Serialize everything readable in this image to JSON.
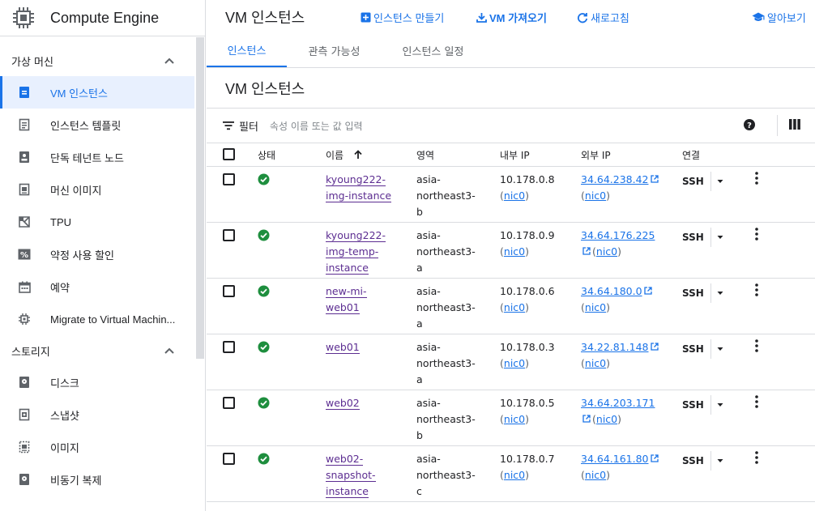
{
  "app": {
    "title": "Compute Engine"
  },
  "sidebar": {
    "sections": [
      {
        "label": "가상 머신",
        "items": [
          {
            "label": "VM 인스턴스",
            "icon": "vm-instance-icon",
            "active": true
          },
          {
            "label": "인스턴스 템플릿",
            "icon": "template-icon"
          },
          {
            "label": "단독 테넌트 노드",
            "icon": "sole-tenant-icon"
          },
          {
            "label": "머신 이미지",
            "icon": "machine-image-icon"
          },
          {
            "label": "TPU",
            "icon": "tpu-icon"
          },
          {
            "label": "약정 사용 할인",
            "icon": "percent-icon"
          },
          {
            "label": "예약",
            "icon": "calendar-icon"
          },
          {
            "label": "Migrate to Virtual Machin...",
            "icon": "migrate-icon"
          }
        ]
      },
      {
        "label": "스토리지",
        "items": [
          {
            "label": "디스크",
            "icon": "disk-icon"
          },
          {
            "label": "스냅샷",
            "icon": "snapshot-icon"
          },
          {
            "label": "이미지",
            "icon": "image-icon"
          },
          {
            "label": "비동기 복제",
            "icon": "async-replication-icon"
          }
        ]
      }
    ]
  },
  "header": {
    "page_title": "VM 인스턴스",
    "create_label": "인스턴스 만들기",
    "import_label": "VM 가져오기",
    "refresh_label": "새로고침",
    "learn_label": "알아보기"
  },
  "tabs": [
    {
      "label": "인스턴스",
      "active": true
    },
    {
      "label": "관측 가능성"
    },
    {
      "label": "인스턴스 일정"
    }
  ],
  "section_title": "VM 인스턴스",
  "filter": {
    "label": "필터",
    "placeholder": "속성 이름 또는 값 입력"
  },
  "table": {
    "headers": {
      "status": "상태",
      "name": "이름",
      "zone": "영역",
      "internal_ip": "내부 IP",
      "external_ip": "외부 IP",
      "connect": "연결"
    },
    "rows": [
      {
        "name_lines": [
          "kyoung222-",
          "img-instance"
        ],
        "zone_lines": [
          "asia-",
          "northeast3-",
          "b"
        ],
        "internal_ip": "10.178.0.8",
        "nic": "nic0",
        "external_ip": "34.64.238.42",
        "ext_nic": "nic0",
        "connect": "SSH"
      },
      {
        "name_lines": [
          "kyoung222-",
          "img-temp-",
          "instance"
        ],
        "zone_lines": [
          "asia-",
          "northeast3-",
          "a"
        ],
        "internal_ip": "10.178.0.9",
        "nic": "nic0",
        "external_ip": "34.64.176.225",
        "ext_nic": "nic0",
        "connect": "SSH"
      },
      {
        "name_lines": [
          "new-mi-",
          "web01"
        ],
        "zone_lines": [
          "asia-",
          "northeast3-",
          "a"
        ],
        "internal_ip": "10.178.0.6",
        "nic": "nic0",
        "external_ip": "34.64.180.0",
        "ext_nic": "nic0",
        "connect": "SSH"
      },
      {
        "name_lines": [
          "web01"
        ],
        "zone_lines": [
          "asia-",
          "northeast3-",
          "a"
        ],
        "internal_ip": "10.178.0.3",
        "nic": "nic0",
        "external_ip": "34.22.81.148",
        "ext_nic": "nic0",
        "connect": "SSH"
      },
      {
        "name_lines": [
          "web02"
        ],
        "zone_lines": [
          "asia-",
          "northeast3-",
          "b"
        ],
        "internal_ip": "10.178.0.5",
        "nic": "nic0",
        "external_ip": "34.64.203.171",
        "ext_nic": "nic0",
        "connect": "SSH"
      },
      {
        "name_lines": [
          "web02-",
          "snapshot-",
          "instance"
        ],
        "zone_lines": [
          "asia-",
          "northeast3-",
          "c"
        ],
        "internal_ip": "10.178.0.7",
        "nic": "nic0",
        "external_ip": "34.64.161.80",
        "ext_nic": "nic0",
        "connect": "SSH"
      }
    ]
  },
  "colors": {
    "accent": "#1a73e8",
    "status_ok": "#1e8e3e",
    "link_visited": "#7b1fa2"
  }
}
